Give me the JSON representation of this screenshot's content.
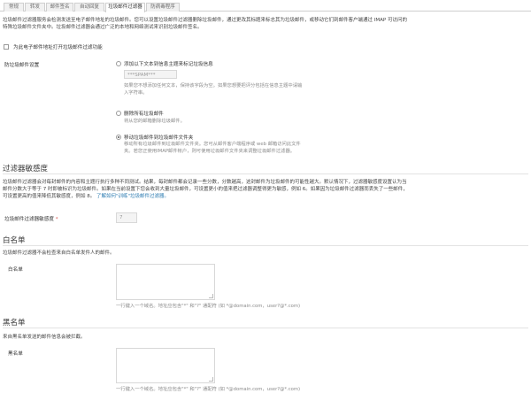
{
  "tabs": [
    {
      "label": "常规"
    },
    {
      "label": "转发"
    },
    {
      "label": "邮件签名"
    },
    {
      "label": "自动回复"
    },
    {
      "label": "垃圾邮件过滤器"
    },
    {
      "label": "防病毒程序"
    }
  ],
  "intro": {
    "line1": "垃圾邮件过滤器服务会检测发送至电子邮件地址的垃圾邮件。您可以设置垃圾邮件过滤器删除垃圾邮件，通过更改其标题来标志其为垃圾邮件，或移动它们到邮件客户端通过 IMAP 可访问的",
    "line2": "特殊垃圾邮件文件夹中。垃圾邮件过滤器会通过广泛的本地和网络测试来识别垃圾邮件签名。"
  },
  "enable": {
    "label": "为此电子邮件地址打开垃圾邮件过滤功能"
  },
  "settings": {
    "label": "防垃圾邮件设置",
    "option1": {
      "label": "添加以下文本到信息主题来标记垃圾信息",
      "placeholder": "***SPAM***",
      "help1": "如果您不想添加任何文本，保持该字段为空。如果您想要把评分包括在信息主题中请输",
      "help2": "入字符串。"
    },
    "option2": {
      "label": "删除所有垃圾邮件",
      "help": "将从您的邮箱删除垃圾邮件。"
    },
    "option3": {
      "label": "移动垃圾邮件到垃圾邮件文件夹",
      "help1": "移动所有垃圾邮件到垃圾邮件文件夹。您可从邮件客户端程序或 web 邮箱访问此文件",
      "help2": "夹。若您正使用IMAP邮件帐户，则可使用垃圾邮件文件夹来调整垃圾邮件过滤器。"
    }
  },
  "sensitivity": {
    "title": "过滤器敏感度",
    "desc1": "垃圾邮件过滤器会对每封邮件的内容和主题行执行多种不同测试。结果，每封邮件都会记录一些分数，分数越高，这封邮件为垃圾邮件的可能性越大。默认情况下，过滤器敏感度设置认为当",
    "desc2": "邮件分数大于等于 7 时即被标识为垃圾邮件。如果在当前设置下您会收到大量垃圾邮件，可设置更小的值来把过滤器调整得更为敏感，例如 6。如果因为垃圾邮件过滤器而丢失了一些邮件，",
    "desc3": "可设置更高的值来降低其敏感度，例如 8。",
    "link": "了解如何\"训练\"垃圾邮件过滤器。",
    "field_label": "垃圾邮件过滤器敏感度",
    "required_mark": "*",
    "value": "7"
  },
  "whitelist": {
    "title": "白名单",
    "desc": "垃圾邮件过滤器不会检查来自白名单发件人的邮件。",
    "field_label": "白名单",
    "hint": "一行键入一个域名。地址应包含\"*\" 和\"?\" 通配符 (如 *@domain.com，user?@*.com)"
  },
  "blacklist": {
    "title": "黑名单",
    "desc": "来自黑名单发送的邮件信息会被拦截。",
    "field_label": "黑名单",
    "hint": "一行键入一个域名。地址应包含\"*\" 和\"?\" 通配符 (如 *@domain.com，user?@*.com)"
  }
}
